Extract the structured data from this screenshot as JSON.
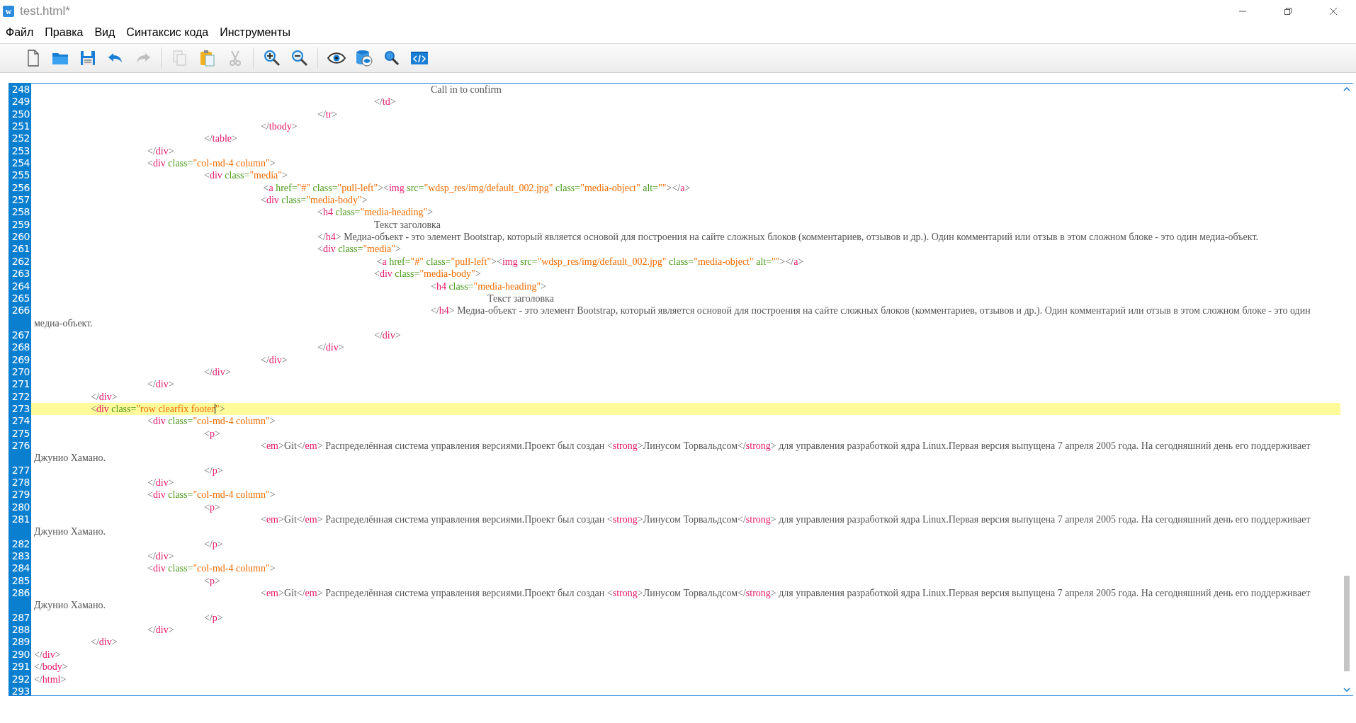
{
  "window": {
    "app_icon": "w",
    "title": "test.html*"
  },
  "menu": [
    "Файл",
    "Правка",
    "Вид",
    "Синтаксис кода",
    "Инструменты"
  ],
  "toolbar": [
    [
      {
        "kind": "new",
        "disabled": false
      },
      {
        "kind": "open",
        "disabled": false
      },
      {
        "kind": "save",
        "disabled": false
      },
      {
        "kind": "undo",
        "disabled": false
      },
      {
        "kind": "redo",
        "disabled": true
      }
    ],
    [
      {
        "kind": "copy",
        "disabled": true
      },
      {
        "kind": "paste",
        "disabled": false
      },
      {
        "kind": "cut",
        "disabled": true
      }
    ],
    [
      {
        "kind": "zoom_in",
        "disabled": false
      },
      {
        "kind": "zoom_out",
        "disabled": false
      }
    ],
    [
      {
        "kind": "preview",
        "disabled": false
      },
      {
        "kind": "db_preview",
        "disabled": false
      },
      {
        "kind": "search",
        "disabled": false
      },
      {
        "kind": "code",
        "disabled": false
      }
    ]
  ],
  "lines": [
    {
      "number": "248",
      "current": false,
      "tokens": [
        {
          "kind": "text",
          "text": "\t\t\t\t\t\t\tCall in to confirm"
        }
      ]
    },
    {
      "number": "249",
      "current": false,
      "tokens": [
        {
          "kind": "punct",
          "text": "\t\t\t\t\t\t</"
        },
        {
          "kind": "tag",
          "text": "td"
        },
        {
          "kind": "punct",
          "text": ">"
        }
      ]
    },
    {
      "number": "250",
      "current": false,
      "tokens": [
        {
          "kind": "punct",
          "text": "\t\t\t\t\t</"
        },
        {
          "kind": "tag",
          "text": "tr"
        },
        {
          "kind": "punct",
          "text": ">"
        }
      ]
    },
    {
      "number": "251",
      "current": false,
      "tokens": [
        {
          "kind": "punct",
          "text": "\t\t\t\t</"
        },
        {
          "kind": "tag",
          "text": "tbody"
        },
        {
          "kind": "punct",
          "text": ">"
        }
      ]
    },
    {
      "number": "252",
      "current": false,
      "tokens": [
        {
          "kind": "punct",
          "text": "\t\t\t</"
        },
        {
          "kind": "tag",
          "text": "table"
        },
        {
          "kind": "punct",
          "text": ">"
        }
      ]
    },
    {
      "number": "253",
      "current": false,
      "tokens": [
        {
          "kind": "punct",
          "text": "\t\t</"
        },
        {
          "kind": "tag",
          "text": "div"
        },
        {
          "kind": "punct",
          "text": ">"
        }
      ]
    },
    {
      "number": "254",
      "current": false,
      "tokens": [
        {
          "kind": "punct",
          "text": "\t\t<"
        },
        {
          "kind": "tag",
          "text": "div"
        },
        {
          "kind": "attr",
          "text": " class="
        },
        {
          "kind": "value",
          "text": "\"col-md-4 column\""
        },
        {
          "kind": "punct",
          "text": ">"
        }
      ]
    },
    {
      "number": "255",
      "current": false,
      "tokens": [
        {
          "kind": "punct",
          "text": "\t\t\t<"
        },
        {
          "kind": "tag",
          "text": "div"
        },
        {
          "kind": "attr",
          "text": " class="
        },
        {
          "kind": "value",
          "text": "\"media\""
        },
        {
          "kind": "punct",
          "text": ">"
        }
      ]
    },
    {
      "number": "256",
      "current": false,
      "tokens": [
        {
          "kind": "punct",
          "text": "\t\t\t\t <"
        },
        {
          "kind": "tag",
          "text": "a"
        },
        {
          "kind": "attr",
          "text": " href="
        },
        {
          "kind": "value",
          "text": "\"#\""
        },
        {
          "kind": "attr",
          "text": " class="
        },
        {
          "kind": "value",
          "text": "\"pull-left\""
        },
        {
          "kind": "punct",
          "text": "><"
        },
        {
          "kind": "tag",
          "text": "img"
        },
        {
          "kind": "attr",
          "text": " src="
        },
        {
          "kind": "value",
          "text": "\"wdsp_res/img/default_002.jpg\""
        },
        {
          "kind": "attr",
          "text": " class="
        },
        {
          "kind": "value",
          "text": "\"media-object\""
        },
        {
          "kind": "attr",
          "text": " alt="
        },
        {
          "kind": "value",
          "text": "\"\""
        },
        {
          "kind": "punct",
          "text": "></"
        },
        {
          "kind": "tag",
          "text": "a"
        },
        {
          "kind": "punct",
          "text": ">"
        }
      ]
    },
    {
      "number": "257",
      "current": false,
      "tokens": [
        {
          "kind": "punct",
          "text": "\t\t\t\t<"
        },
        {
          "kind": "tag",
          "text": "div"
        },
        {
          "kind": "attr",
          "text": " class="
        },
        {
          "kind": "value",
          "text": "\"media-body\""
        },
        {
          "kind": "punct",
          "text": ">"
        }
      ]
    },
    {
      "number": "258",
      "current": false,
      "tokens": [
        {
          "kind": "punct",
          "text": "\t\t\t\t\t<"
        },
        {
          "kind": "tag",
          "text": "h4"
        },
        {
          "kind": "attr",
          "text": " class="
        },
        {
          "kind": "value",
          "text": "\"media-heading\""
        },
        {
          "kind": "punct",
          "text": ">"
        }
      ]
    },
    {
      "number": "259",
      "current": false,
      "tokens": [
        {
          "kind": "text",
          "text": "\t\t\t\t\t\tТекст заголовка"
        }
      ]
    },
    {
      "number": "260",
      "current": false,
      "tokens": [
        {
          "kind": "punct",
          "text": "\t\t\t\t\t</"
        },
        {
          "kind": "tag",
          "text": "h4"
        },
        {
          "kind": "punct",
          "text": ">"
        },
        {
          "kind": "text",
          "text": " Медиа-объект - это элемент Bootstrap, который является основой для построения на сайте сложных блоков (комментариев, отзывов и др.). Один комментарий или отзыв в этом сложном блоке - это один медиа-объект."
        }
      ]
    },
    {
      "number": "261",
      "current": false,
      "tokens": [
        {
          "kind": "punct",
          "text": "\t\t\t\t\t<"
        },
        {
          "kind": "tag",
          "text": "div"
        },
        {
          "kind": "attr",
          "text": " class="
        },
        {
          "kind": "value",
          "text": "\"media\""
        },
        {
          "kind": "punct",
          "text": ">"
        }
      ]
    },
    {
      "number": "262",
      "current": false,
      "tokens": [
        {
          "kind": "punct",
          "text": "\t\t\t\t\t\t <"
        },
        {
          "kind": "tag",
          "text": "a"
        },
        {
          "kind": "attr",
          "text": " href="
        },
        {
          "kind": "value",
          "text": "\"#\""
        },
        {
          "kind": "attr",
          "text": " class="
        },
        {
          "kind": "value",
          "text": "\"pull-left\""
        },
        {
          "kind": "punct",
          "text": "><"
        },
        {
          "kind": "tag",
          "text": "img"
        },
        {
          "kind": "attr",
          "text": " src="
        },
        {
          "kind": "value",
          "text": "\"wdsp_res/img/default_002.jpg\""
        },
        {
          "kind": "attr",
          "text": " class="
        },
        {
          "kind": "value",
          "text": "\"media-object\""
        },
        {
          "kind": "attr",
          "text": " alt="
        },
        {
          "kind": "value",
          "text": "\"\""
        },
        {
          "kind": "punct",
          "text": "></"
        },
        {
          "kind": "tag",
          "text": "a"
        },
        {
          "kind": "punct",
          "text": ">"
        }
      ]
    },
    {
      "number": "263",
      "current": false,
      "tokens": [
        {
          "kind": "punct",
          "text": "\t\t\t\t\t\t<"
        },
        {
          "kind": "tag",
          "text": "div"
        },
        {
          "kind": "attr",
          "text": " class="
        },
        {
          "kind": "value",
          "text": "\"media-body\""
        },
        {
          "kind": "punct",
          "text": ">"
        }
      ]
    },
    {
      "number": "264",
      "current": false,
      "tokens": [
        {
          "kind": "punct",
          "text": "\t\t\t\t\t\t\t<"
        },
        {
          "kind": "tag",
          "text": "h4"
        },
        {
          "kind": "attr",
          "text": " class="
        },
        {
          "kind": "value",
          "text": "\"media-heading\""
        },
        {
          "kind": "punct",
          "text": ">"
        }
      ]
    },
    {
      "number": "265",
      "current": false,
      "tokens": [
        {
          "kind": "text",
          "text": "\t\t\t\t\t\t\t\tТекст заголовка"
        }
      ]
    },
    {
      "number": "266",
      "current": false,
      "tokens": [
        {
          "kind": "punct",
          "text": "\t\t\t\t\t\t\t</"
        },
        {
          "kind": "tag",
          "text": "h4"
        },
        {
          "kind": "punct",
          "text": ">"
        },
        {
          "kind": "text",
          "text": " Медиа-объект - это элемент Bootstrap, который является основой для построения на сайте сложных блоков (комментариев, отзывов и др.). Один комментарий или отзыв в этом сложном блоке - это один медиа-объект."
        }
      ]
    },
    {
      "number": "267",
      "current": false,
      "tokens": [
        {
          "kind": "punct",
          "text": "\t\t\t\t\t\t</"
        },
        {
          "kind": "tag",
          "text": "div"
        },
        {
          "kind": "punct",
          "text": ">"
        }
      ]
    },
    {
      "number": "268",
      "current": false,
      "tokens": [
        {
          "kind": "punct",
          "text": "\t\t\t\t\t</"
        },
        {
          "kind": "tag",
          "text": "div"
        },
        {
          "kind": "punct",
          "text": ">"
        }
      ]
    },
    {
      "number": "269",
      "current": false,
      "tokens": [
        {
          "kind": "punct",
          "text": "\t\t\t\t</"
        },
        {
          "kind": "tag",
          "text": "div"
        },
        {
          "kind": "punct",
          "text": ">"
        }
      ]
    },
    {
      "number": "270",
      "current": false,
      "tokens": [
        {
          "kind": "punct",
          "text": "\t\t\t</"
        },
        {
          "kind": "tag",
          "text": "div"
        },
        {
          "kind": "punct",
          "text": ">"
        }
      ]
    },
    {
      "number": "271",
      "current": false,
      "tokens": [
        {
          "kind": "punct",
          "text": "\t\t</"
        },
        {
          "kind": "tag",
          "text": "div"
        },
        {
          "kind": "punct",
          "text": ">"
        }
      ]
    },
    {
      "number": "272",
      "current": false,
      "tokens": [
        {
          "kind": "punct",
          "text": "\t</"
        },
        {
          "kind": "tag",
          "text": "div"
        },
        {
          "kind": "punct",
          "text": ">"
        }
      ]
    },
    {
      "number": "273",
      "current": true,
      "tokens": [
        {
          "kind": "punct",
          "text": "\t<"
        },
        {
          "kind": "tag",
          "text": "div"
        },
        {
          "kind": "attr",
          "text": " class="
        },
        {
          "kind": "value",
          "text": "\"row clearfix footer"
        },
        {
          "kind": "caret"
        },
        {
          "kind": "value",
          "text": "\""
        },
        {
          "kind": "punct",
          "text": ">"
        }
      ]
    },
    {
      "number": "274",
      "current": false,
      "tokens": [
        {
          "kind": "punct",
          "text": "\t\t<"
        },
        {
          "kind": "tag",
          "text": "div"
        },
        {
          "kind": "attr",
          "text": " class="
        },
        {
          "kind": "value",
          "text": "\"col-md-4 column\""
        },
        {
          "kind": "punct",
          "text": ">"
        }
      ]
    },
    {
      "number": "275",
      "current": false,
      "tokens": [
        {
          "kind": "punct",
          "text": "\t\t\t<"
        },
        {
          "kind": "tag",
          "text": "p"
        },
        {
          "kind": "punct",
          "text": ">"
        }
      ]
    },
    {
      "number": "276",
      "current": false,
      "tokens": [
        {
          "kind": "punct",
          "text": "\t\t\t\t<"
        },
        {
          "kind": "tag",
          "text": "em"
        },
        {
          "kind": "punct",
          "text": ">"
        },
        {
          "kind": "text",
          "text": "Git"
        },
        {
          "kind": "punct",
          "text": "</"
        },
        {
          "kind": "tag",
          "text": "em"
        },
        {
          "kind": "punct",
          "text": ">"
        },
        {
          "kind": "text",
          "text": " Распределённая система управления версиями.Проект был создан "
        },
        {
          "kind": "punct",
          "text": "<"
        },
        {
          "kind": "tag",
          "text": "strong"
        },
        {
          "kind": "punct",
          "text": ">"
        },
        {
          "kind": "text",
          "text": "Линусом Торвальдсом"
        },
        {
          "kind": "punct",
          "text": "</"
        },
        {
          "kind": "tag",
          "text": "strong"
        },
        {
          "kind": "punct",
          "text": ">"
        },
        {
          "kind": "text",
          "text": " для управления разработкой ядра Linux.Первая версия выпущена 7 апреля 2005 года. На сегодняшний день его поддерживает Джунио Хамано."
        }
      ]
    },
    {
      "number": "277",
      "current": false,
      "tokens": [
        {
          "kind": "punct",
          "text": "\t\t\t</"
        },
        {
          "kind": "tag",
          "text": "p"
        },
        {
          "kind": "punct",
          "text": ">"
        }
      ]
    },
    {
      "number": "278",
      "current": false,
      "tokens": [
        {
          "kind": "punct",
          "text": "\t\t</"
        },
        {
          "kind": "tag",
          "text": "div"
        },
        {
          "kind": "punct",
          "text": ">"
        }
      ]
    },
    {
      "number": "279",
      "current": false,
      "tokens": [
        {
          "kind": "punct",
          "text": "\t\t<"
        },
        {
          "kind": "tag",
          "text": "div"
        },
        {
          "kind": "attr",
          "text": " class="
        },
        {
          "kind": "value",
          "text": "\"col-md-4 column\""
        },
        {
          "kind": "punct",
          "text": ">"
        }
      ]
    },
    {
      "number": "280",
      "current": false,
      "tokens": [
        {
          "kind": "punct",
          "text": "\t\t\t<"
        },
        {
          "kind": "tag",
          "text": "p"
        },
        {
          "kind": "punct",
          "text": ">"
        }
      ]
    },
    {
      "number": "281",
      "current": false,
      "tokens": [
        {
          "kind": "punct",
          "text": "\t\t\t\t<"
        },
        {
          "kind": "tag",
          "text": "em"
        },
        {
          "kind": "punct",
          "text": ">"
        },
        {
          "kind": "text",
          "text": "Git"
        },
        {
          "kind": "punct",
          "text": "</"
        },
        {
          "kind": "tag",
          "text": "em"
        },
        {
          "kind": "punct",
          "text": ">"
        },
        {
          "kind": "text",
          "text": " Распределённая система управления версиями.Проект был создан "
        },
        {
          "kind": "punct",
          "text": "<"
        },
        {
          "kind": "tag",
          "text": "strong"
        },
        {
          "kind": "punct",
          "text": ">"
        },
        {
          "kind": "text",
          "text": "Линусом Торвальдсом"
        },
        {
          "kind": "punct",
          "text": "</"
        },
        {
          "kind": "tag",
          "text": "strong"
        },
        {
          "kind": "punct",
          "text": ">"
        },
        {
          "kind": "text",
          "text": " для управления разработкой ядра Linux.Первая версия выпущена 7 апреля 2005 года. На сегодняшний день его поддерживает Джунио Хамано."
        }
      ]
    },
    {
      "number": "282",
      "current": false,
      "tokens": [
        {
          "kind": "punct",
          "text": "\t\t\t</"
        },
        {
          "kind": "tag",
          "text": "p"
        },
        {
          "kind": "punct",
          "text": ">"
        }
      ]
    },
    {
      "number": "283",
      "current": false,
      "tokens": [
        {
          "kind": "punct",
          "text": "\t\t</"
        },
        {
          "kind": "tag",
          "text": "div"
        },
        {
          "kind": "punct",
          "text": ">"
        }
      ]
    },
    {
      "number": "284",
      "current": false,
      "tokens": [
        {
          "kind": "punct",
          "text": "\t\t<"
        },
        {
          "kind": "tag",
          "text": "div"
        },
        {
          "kind": "attr",
          "text": " class="
        },
        {
          "kind": "value",
          "text": "\"col-md-4 column\""
        },
        {
          "kind": "punct",
          "text": ">"
        }
      ]
    },
    {
      "number": "285",
      "current": false,
      "tokens": [
        {
          "kind": "punct",
          "text": "\t\t\t<"
        },
        {
          "kind": "tag",
          "text": "p"
        },
        {
          "kind": "punct",
          "text": ">"
        }
      ]
    },
    {
      "number": "286",
      "current": false,
      "tokens": [
        {
          "kind": "punct",
          "text": "\t\t\t\t<"
        },
        {
          "kind": "tag",
          "text": "em"
        },
        {
          "kind": "punct",
          "text": ">"
        },
        {
          "kind": "text",
          "text": "Git"
        },
        {
          "kind": "punct",
          "text": "</"
        },
        {
          "kind": "tag",
          "text": "em"
        },
        {
          "kind": "punct",
          "text": ">"
        },
        {
          "kind": "text",
          "text": " Распределённая система управления версиями.Проект был создан "
        },
        {
          "kind": "punct",
          "text": "<"
        },
        {
          "kind": "tag",
          "text": "strong"
        },
        {
          "kind": "punct",
          "text": ">"
        },
        {
          "kind": "text",
          "text": "Линусом Торвальдсом"
        },
        {
          "kind": "punct",
          "text": "</"
        },
        {
          "kind": "tag",
          "text": "strong"
        },
        {
          "kind": "punct",
          "text": ">"
        },
        {
          "kind": "text",
          "text": " для управления разработкой ядра Linux.Первая версия выпущена 7 апреля 2005 года. На сегодняшний день его поддерживает Джунио Хамано."
        }
      ]
    },
    {
      "number": "287",
      "current": false,
      "tokens": [
        {
          "kind": "punct",
          "text": "\t\t\t</"
        },
        {
          "kind": "tag",
          "text": "p"
        },
        {
          "kind": "punct",
          "text": ">"
        }
      ]
    },
    {
      "number": "288",
      "current": false,
      "tokens": [
        {
          "kind": "punct",
          "text": "\t\t</"
        },
        {
          "kind": "tag",
          "text": "div"
        },
        {
          "kind": "punct",
          "text": ">"
        }
      ]
    },
    {
      "number": "289",
      "current": false,
      "tokens": [
        {
          "kind": "punct",
          "text": "\t</"
        },
        {
          "kind": "tag",
          "text": "div"
        },
        {
          "kind": "punct",
          "text": ">"
        }
      ]
    },
    {
      "number": "290",
      "current": false,
      "tokens": [
        {
          "kind": "punct",
          "text": "</"
        },
        {
          "kind": "tag",
          "text": "div"
        },
        {
          "kind": "punct",
          "text": ">"
        }
      ]
    },
    {
      "number": "291",
      "current": false,
      "tokens": [
        {
          "kind": "punct",
          "text": "</"
        },
        {
          "kind": "tag",
          "text": "body"
        },
        {
          "kind": "punct",
          "text": ">"
        }
      ]
    },
    {
      "number": "292",
      "current": false,
      "tokens": [
        {
          "kind": "punct",
          "text": "</"
        },
        {
          "kind": "tag",
          "text": "html"
        },
        {
          "kind": "punct",
          "text": ">"
        }
      ]
    },
    {
      "number": "293",
      "current": false
    }
  ]
}
